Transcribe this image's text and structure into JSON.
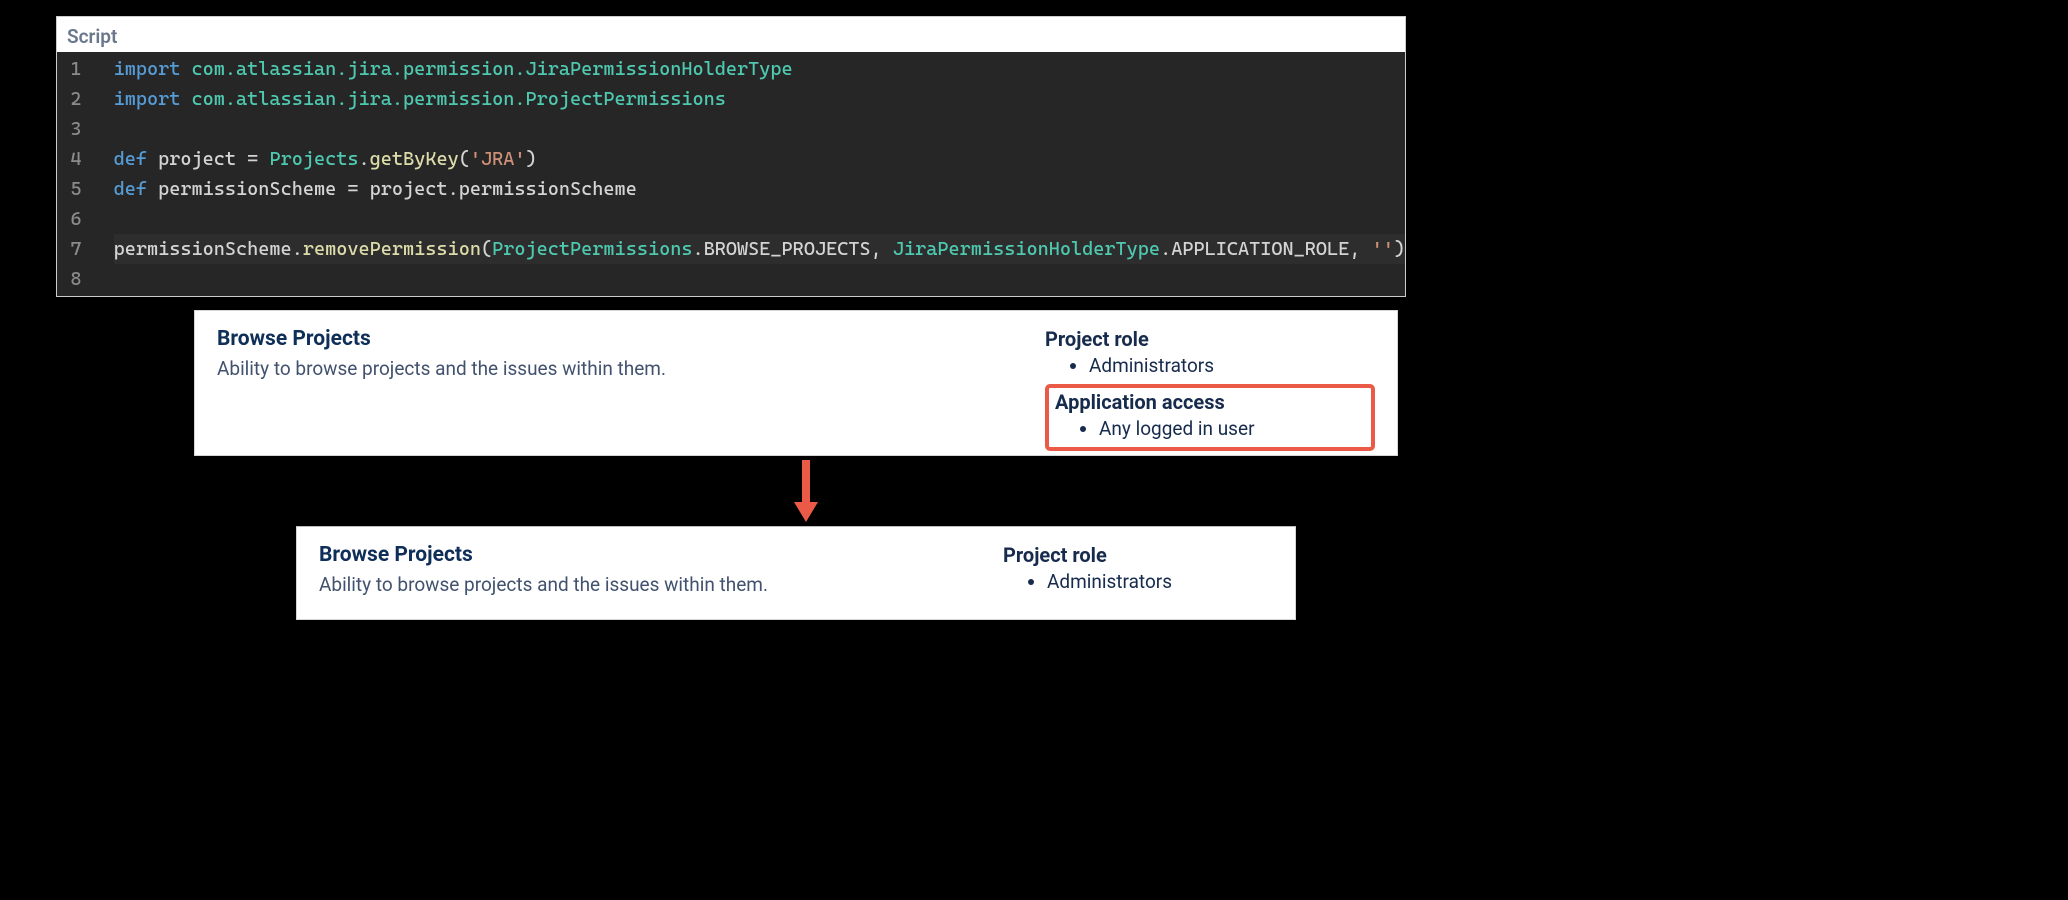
{
  "script": {
    "label": "Script",
    "code": {
      "lines": [
        {
          "n": 1,
          "tokens": [
            {
              "t": "import",
              "c": "t-keyword"
            },
            {
              "t": " com.atlassian.jira.permission.JiraPermissionHolderType",
              "c": "t-type"
            }
          ]
        },
        {
          "n": 2,
          "tokens": [
            {
              "t": "import",
              "c": "t-keyword"
            },
            {
              "t": " com.atlassian.jira.permission.ProjectPermissions",
              "c": "t-type"
            }
          ]
        },
        {
          "n": 3,
          "tokens": []
        },
        {
          "n": 4,
          "tokens": [
            {
              "t": "def",
              "c": "t-keyword"
            },
            {
              "t": " project ",
              "c": ""
            },
            {
              "t": "=",
              "c": "t-punct"
            },
            {
              "t": " ",
              "c": ""
            },
            {
              "t": "Projects",
              "c": "t-type"
            },
            {
              "t": ".",
              "c": "t-punct"
            },
            {
              "t": "getByKey",
              "c": "t-method"
            },
            {
              "t": "(",
              "c": "t-punct"
            },
            {
              "t": "'JRA'",
              "c": "t-string"
            },
            {
              "t": ")",
              "c": "t-punct"
            }
          ]
        },
        {
          "n": 5,
          "tokens": [
            {
              "t": "def",
              "c": "t-keyword"
            },
            {
              "t": " permissionScheme ",
              "c": ""
            },
            {
              "t": "=",
              "c": "t-punct"
            },
            {
              "t": " project.permissionScheme",
              "c": ""
            }
          ]
        },
        {
          "n": 6,
          "tokens": []
        },
        {
          "n": 7,
          "active": true,
          "tokens": [
            {
              "t": "permissionScheme.",
              "c": ""
            },
            {
              "t": "removePermission",
              "c": "t-method"
            },
            {
              "t": "(",
              "c": "t-punct"
            },
            {
              "t": "ProjectPermissions",
              "c": "t-type"
            },
            {
              "t": ".BROWSE_PROJECTS, ",
              "c": ""
            },
            {
              "t": "JiraPermissionHolderType",
              "c": "t-type"
            },
            {
              "t": ".APPLICATION_ROLE, ",
              "c": ""
            },
            {
              "t": "''",
              "c": "t-string"
            },
            {
              "t": ")",
              "c": "t-punct"
            }
          ]
        },
        {
          "n": 8,
          "tokens": []
        }
      ]
    }
  },
  "cardBefore": {
    "title": "Browse Projects",
    "desc": "Ability to browse projects and the issues within them.",
    "projectRoleHeading": "Project role",
    "projectRoleItems": [
      "Administrators"
    ],
    "appAccessHeading": "Application access",
    "appAccessItems": [
      "Any logged in user"
    ]
  },
  "cardAfter": {
    "title": "Browse Projects",
    "desc": "Ability to browse projects and the issues within them.",
    "projectRoleHeading": "Project role",
    "projectRoleItems": [
      "Administrators"
    ]
  }
}
